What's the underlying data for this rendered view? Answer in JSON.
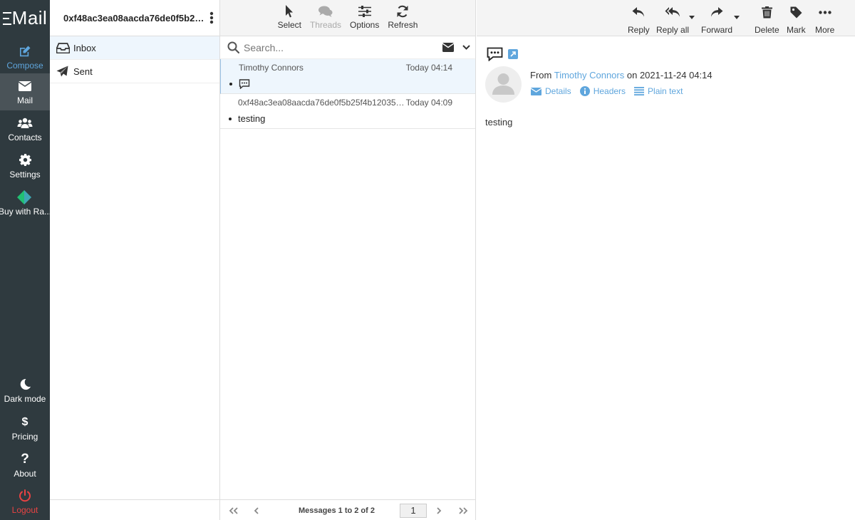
{
  "app": {
    "logo": "Mail"
  },
  "nav": {
    "compose": "Compose",
    "mail": "Mail",
    "contacts": "Contacts",
    "settings": "Settings",
    "buy": "Buy with Ra...",
    "dark_mode": "Dark mode",
    "pricing": "Pricing",
    "about": "About",
    "logout": "Logout"
  },
  "account": {
    "name": "0xf48ac3ea08aacda76de0f5b25f..."
  },
  "folders": [
    {
      "label": "Inbox"
    },
    {
      "label": "Sent"
    }
  ],
  "list_toolbar": {
    "select": "Select",
    "threads": "Threads",
    "options": "Options",
    "refresh": "Refresh"
  },
  "search": {
    "placeholder": "Search..."
  },
  "messages": [
    {
      "from": "Timothy Connors",
      "date": "Today 04:14",
      "subject": ""
    },
    {
      "from": "0xf48ac3ea08aacda76de0f5b25f4b1203563...",
      "date": "Today 04:09",
      "subject": "testing"
    }
  ],
  "pager": {
    "count": "Messages 1 to 2 of 2",
    "page": "1"
  },
  "reader_toolbar": {
    "reply": "Reply",
    "reply_all": "Reply all",
    "forward": "Forward",
    "delete": "Delete",
    "mark": "Mark",
    "more": "More"
  },
  "message": {
    "from_label": "From",
    "sender": "Timothy Connors",
    "date_prefix": "on",
    "date": "2021-11-24 04:14",
    "details": "Details",
    "headers": "Headers",
    "plain_text": "Plain text",
    "body": "testing"
  },
  "colors": {
    "nav_bg": "#2f3a3f",
    "accent": "#5fa6dd",
    "logout": "#e94343"
  }
}
